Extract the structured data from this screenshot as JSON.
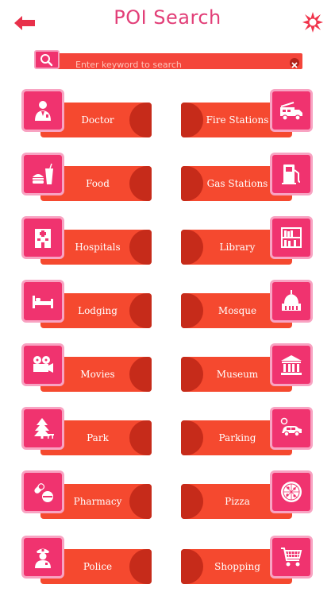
{
  "header": {
    "title": "POI Search",
    "back_icon": "arrow-left-icon",
    "settings_icon": "starburst-settings-icon",
    "accent_color": "#e23f78"
  },
  "search": {
    "placeholder": "Enter keyword to search",
    "value": "",
    "search_icon": "magnifier-icon",
    "clear_icon": "close-icon"
  },
  "categories": [
    {
      "label": "Doctor",
      "icon": "doctor-icon"
    },
    {
      "label": "Fire Stations",
      "icon": "fire-truck-icon"
    },
    {
      "label": "Food",
      "icon": "burger-drink-icon"
    },
    {
      "label": "Gas Stations",
      "icon": "gas-pump-icon"
    },
    {
      "label": "Hospitals",
      "icon": "hospital-building-icon"
    },
    {
      "label": "Library",
      "icon": "bookshelf-icon"
    },
    {
      "label": "Lodging",
      "icon": "bed-icon"
    },
    {
      "label": "Mosque",
      "icon": "mosque-dome-icon"
    },
    {
      "label": "Movies",
      "icon": "movie-camera-icon"
    },
    {
      "label": "Museum",
      "icon": "museum-icon"
    },
    {
      "label": "Park",
      "icon": "tree-icon"
    },
    {
      "label": "Parking",
      "icon": "car-parking-icon"
    },
    {
      "label": "Pharmacy",
      "icon": "pills-icon"
    },
    {
      "label": "Pizza",
      "icon": "pizza-icon"
    },
    {
      "label": "Police",
      "icon": "police-officer-icon"
    },
    {
      "label": "Shopping",
      "icon": "shopping-cart-icon"
    }
  ],
  "colors": {
    "band": "#f5492f",
    "band_curl": "#c62b1a",
    "icon_tile": "#f0336f",
    "icon_tile_border": "#f8a3c2"
  }
}
